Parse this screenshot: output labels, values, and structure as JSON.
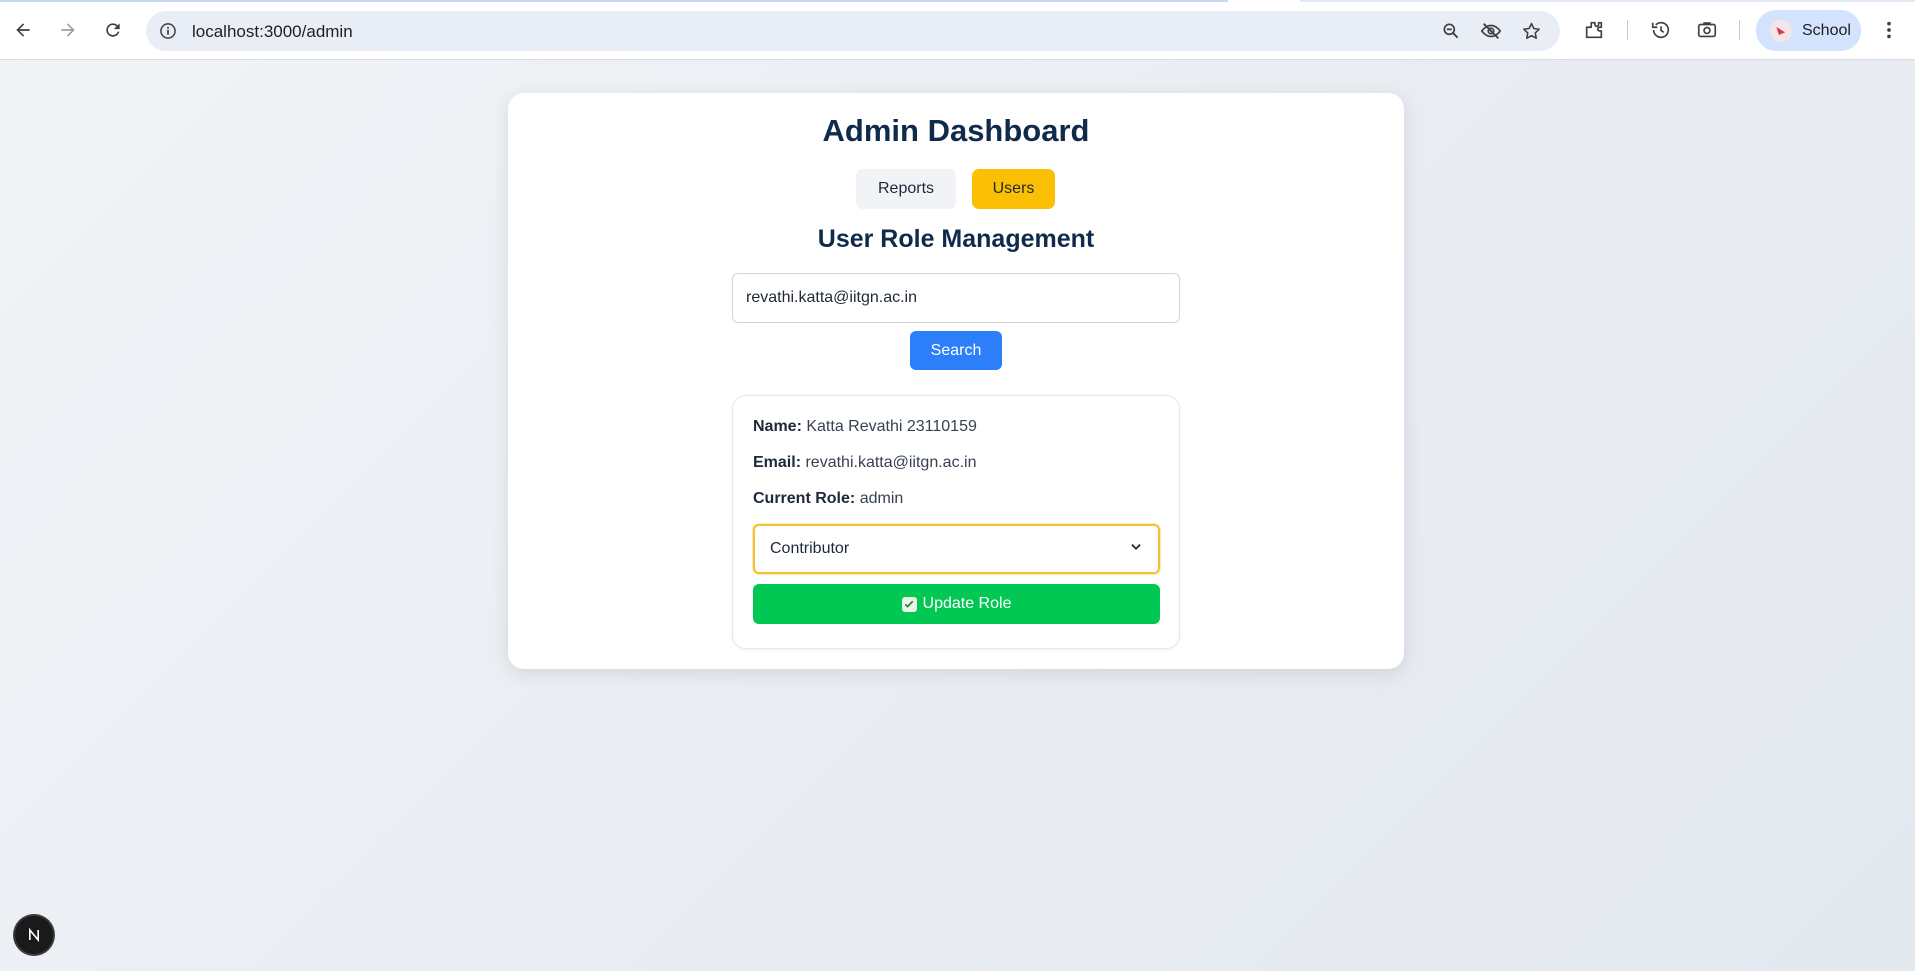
{
  "browser": {
    "url": "localhost:3000/admin",
    "profile_name": "School",
    "icons": [
      "back-icon",
      "forward-icon",
      "reload-icon",
      "site-info-icon",
      "zoom-icon",
      "tracking-protection-icon",
      "bookmark-star-icon",
      "extensions-icon",
      "history-icon",
      "screenshot-icon",
      "kebab-menu-icon"
    ]
  },
  "page": {
    "title": "Admin Dashboard",
    "tabs": [
      {
        "label": "Reports"
      },
      {
        "label": "Users"
      }
    ],
    "section_title": "User Role Management",
    "search": {
      "value": "revathi.katta@iitgn.ac.in",
      "button_label": "Search"
    },
    "user": {
      "name_label": "Name:",
      "name_value": "Katta Revathi 23110159",
      "email_label": "Email:",
      "email_value": "revathi.katta@iitgn.ac.in",
      "role_label": "Current Role:",
      "role_value": "admin"
    },
    "role_select": {
      "selected": "Contributor"
    },
    "update_button_label": "Update Role",
    "next_badge": "N"
  },
  "colors": {
    "active_tab": "#fbc003",
    "search_button": "#2d7ff9",
    "update_button": "#00c853",
    "heading": "#0f2a4a"
  }
}
